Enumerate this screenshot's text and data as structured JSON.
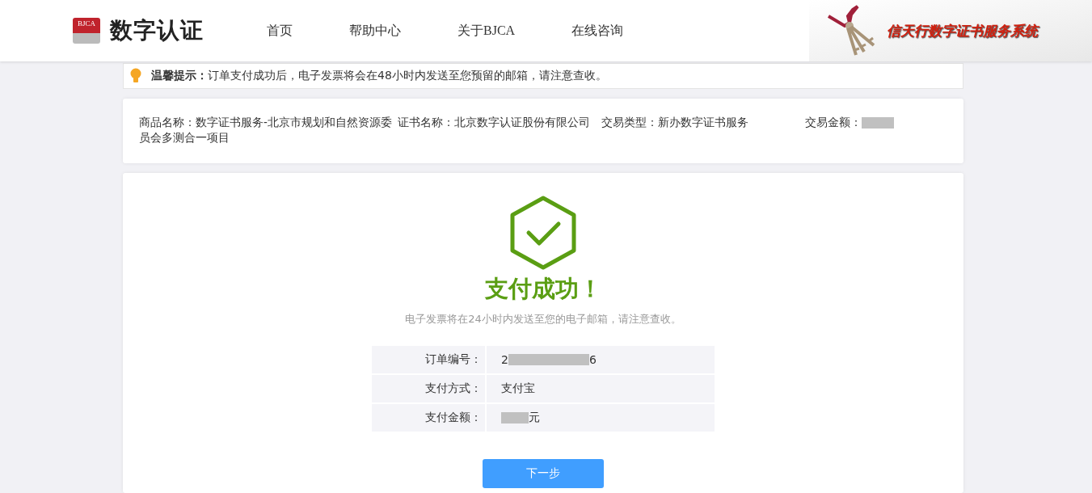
{
  "header": {
    "logo_badge": "BJCA",
    "logo_text": "数字认证",
    "nav": [
      {
        "label": "首页"
      },
      {
        "label": "帮助中心"
      },
      {
        "label": "关于BJCA"
      },
      {
        "label": "在线咨询"
      }
    ],
    "banner_title": "信天行数字证书服务系统"
  },
  "notice": {
    "label": "温馨提示：",
    "text": "订单支付成功后，电子发票将会在48小时内发送至您预留的邮箱，请注意查收。"
  },
  "order_info": [
    {
      "label": "商品名称：",
      "parts": [
        {
          "kind": "text",
          "text": "数字证书服务-北京市规划和自然资源委员会多测合一项目"
        }
      ]
    },
    {
      "label": "证书名称：",
      "parts": [
        {
          "kind": "text",
          "text": "北京数字认证股份有限公司"
        }
      ]
    },
    {
      "label": "交易类型：",
      "parts": [
        {
          "kind": "text",
          "text": "新办数字证书服务"
        }
      ]
    },
    {
      "label": "交易金额：",
      "parts": [
        {
          "kind": "mask"
        }
      ]
    }
  ],
  "result": {
    "title": "支付成功！",
    "message": "电子发票将在24小时内发送至您的电子邮箱，请注意查收。",
    "details": [
      {
        "label": "订单编号：",
        "parts": [
          {
            "kind": "text",
            "text": "2"
          },
          {
            "kind": "mask"
          },
          {
            "kind": "text",
            "text": "6"
          }
        ]
      },
      {
        "label": "支付方式：",
        "parts": [
          {
            "kind": "text",
            "text": "支付宝"
          }
        ]
      },
      {
        "label": "支付金额：",
        "parts": [
          {
            "kind": "mask"
          },
          {
            "kind": "text",
            "text": "元"
          }
        ]
      }
    ],
    "button": "下一步"
  }
}
